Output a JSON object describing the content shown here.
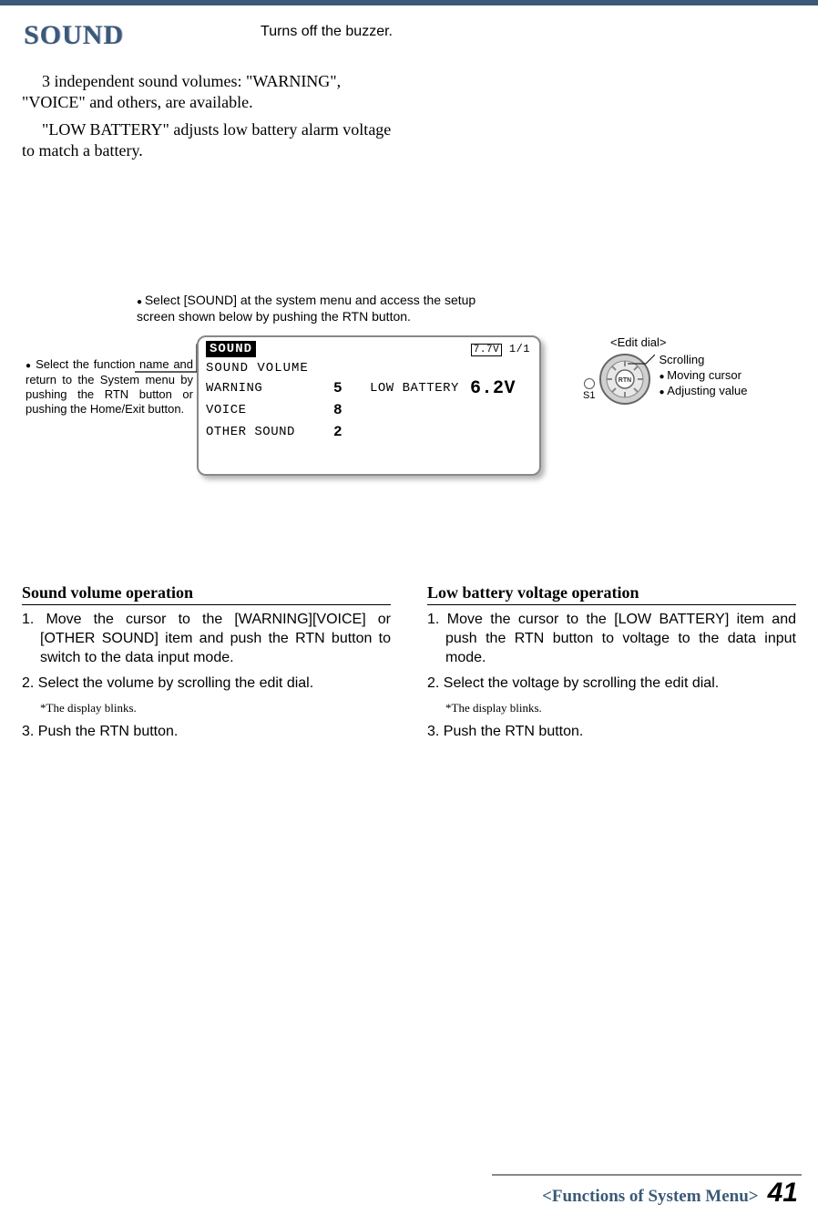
{
  "header": {
    "title": "SOUND",
    "byline": "Turns off the buzzer."
  },
  "intro": {
    "p1": "3 independent sound volumes: \"WARNING\", \"VOICE\" and others, are available.",
    "p2": "\"LOW BATTERY\" adjusts low battery alarm voltage to match a battery."
  },
  "access_note": "Select [SOUND] at the system menu and access the setup screen shown below by pushing the RTN button.",
  "left_note": "Select the function name and return to the System menu by pushing the RTN button or pushing the Home/Exit button.",
  "lcd": {
    "title": "SOUND",
    "voltage": "7.7V",
    "page": "1/1",
    "section": "SOUND VOLUME",
    "rows": [
      {
        "label": "WARNING",
        "value": "5",
        "label2": "LOW BATTERY",
        "value2": "6.2V"
      },
      {
        "label": "VOICE",
        "value": "8",
        "label2": "",
        "value2": ""
      },
      {
        "label": "OTHER SOUND",
        "value": "2",
        "label2": "",
        "value2": ""
      }
    ]
  },
  "dial": {
    "title": "<Edit dial>",
    "s1": "S1",
    "rtn": "RTN",
    "scroll_label": "Scrolling",
    "note1": "Moving cursor",
    "note2": "Adjusting value"
  },
  "ops": {
    "left": {
      "title": "Sound volume operation",
      "step1": "1. Move the cursor to the [WARNING][VOICE] or [OTHER SOUND] item and push the RTN button to switch to the data input mode.",
      "step2": "2. Select the volume by scrolling the edit dial.",
      "note": "*The display blinks.",
      "step3": "3. Push the RTN button."
    },
    "right": {
      "title": "Low battery voltage operation",
      "step1": "1. Move the cursor to the [LOW BATTERY] item and push the RTN button to voltage to the data input mode.",
      "step2": "2. Select the voltage by scrolling the edit dial.",
      "note": "*The display blinks.",
      "step3": "3. Push the RTN button."
    }
  },
  "footer": {
    "label": "<Functions of System Menu>",
    "page": "41"
  }
}
